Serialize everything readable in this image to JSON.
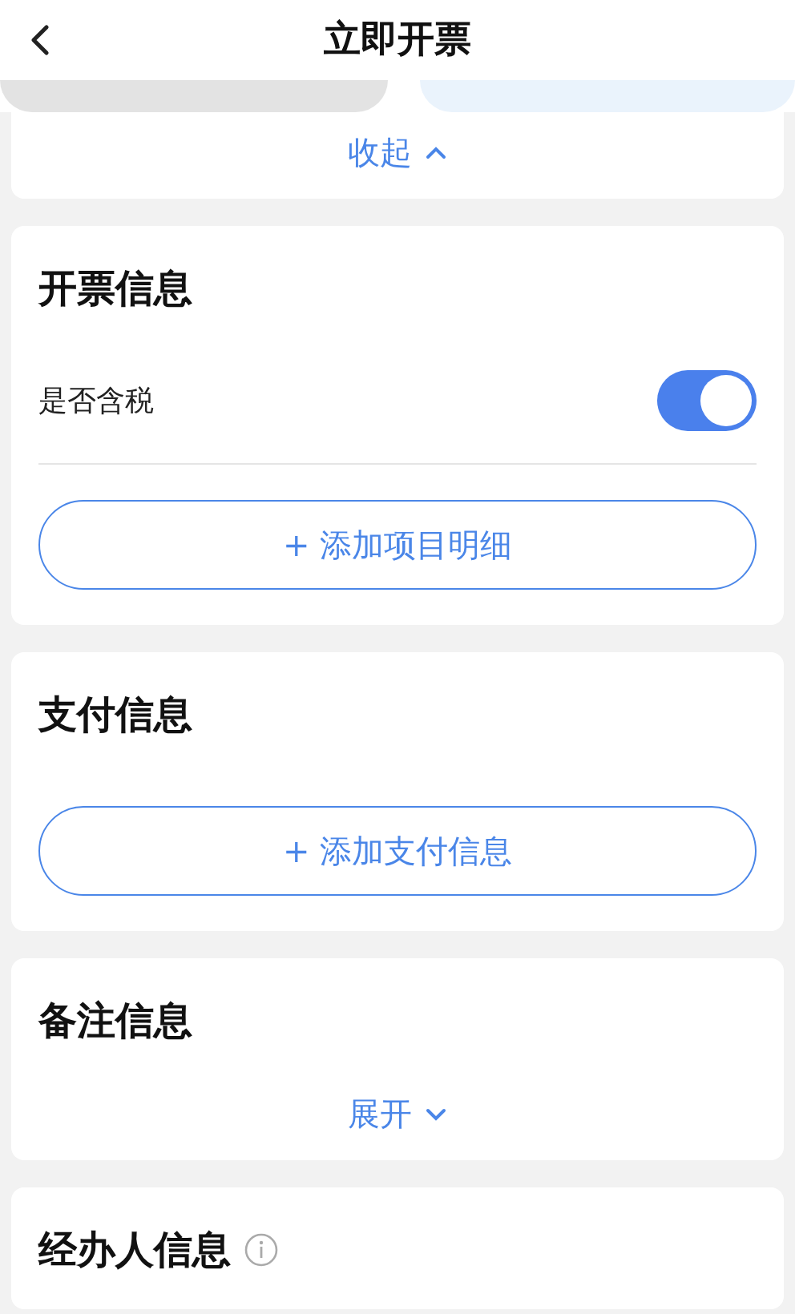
{
  "header": {
    "title": "立即开票"
  },
  "top_section": {
    "toggle_label": "收起",
    "expanded": true
  },
  "sections": [
    {
      "kind": "invoice",
      "title": "开票信息",
      "tax_row": {
        "label": "是否含税",
        "on": true
      },
      "add_button": "+ 添加项目明细"
    },
    {
      "kind": "payment",
      "title": "支付信息",
      "add_button": "+ 添加支付信息"
    },
    {
      "kind": "remark",
      "title": "备注信息",
      "toggle_label": "展开",
      "expanded": false
    },
    {
      "kind": "handler",
      "title": "经办人信息"
    }
  ]
}
